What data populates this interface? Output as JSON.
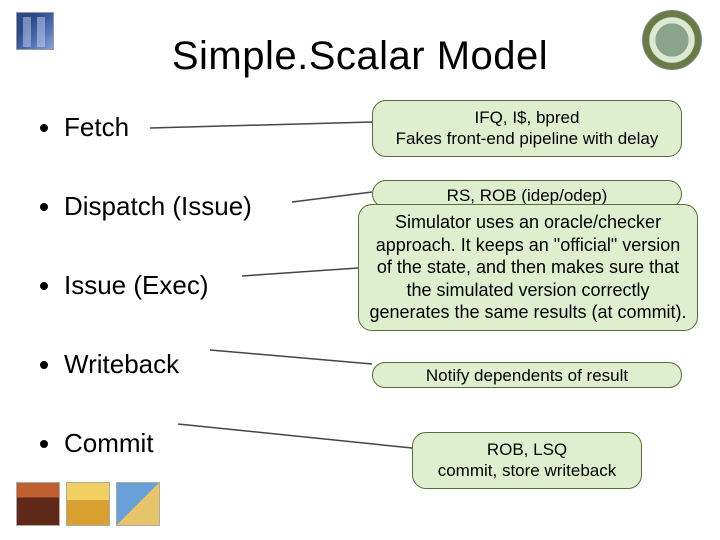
{
  "title": "Simple.Scalar Model",
  "stages": {
    "fetch": "Fetch",
    "dispatch": "Dispatch (Issue)",
    "issue": "Issue (Exec)",
    "writeback": "Writeback",
    "commit": "Commit"
  },
  "boxes": {
    "ifq": "IFQ, I$, bpred\nFakes front-end pipeline with delay",
    "rs": "RS, ROB (idep/odep)",
    "info": "Simulator uses an oracle/checker approach. It keeps an \"official\" version of the state, and then makes sure that the simulated version correctly generates the same results (at commit).",
    "notify": "Notify dependents of result",
    "commit": "ROB, LSQ\ncommit, store writeback"
  }
}
